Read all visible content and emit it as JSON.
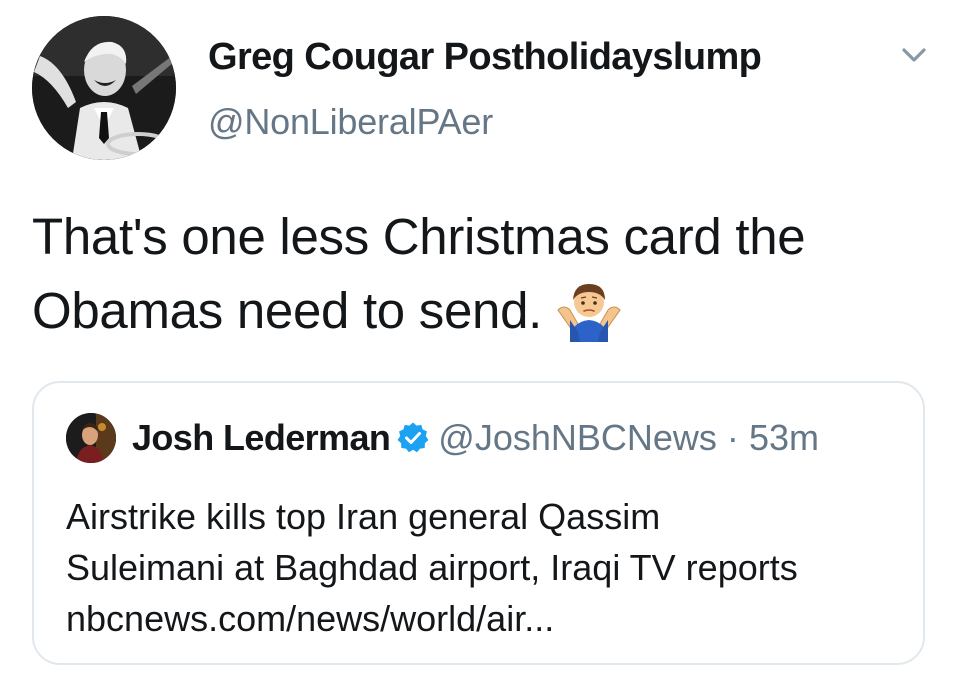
{
  "tweet": {
    "display_name": "Greg Cougar Postholidayslump",
    "handle": "@NonLiberalPAer",
    "text_line1": "That's one less Christmas card the",
    "text_line2": "Obamas need to send.",
    "emoji_icon": "person-shrugging-icon",
    "caret_icon": "chevron-down-icon"
  },
  "quoted_tweet": {
    "display_name": "Josh Lederman",
    "verified_icon": "verified-badge-icon",
    "handle": "@JoshNBCNews",
    "separator": "·",
    "time": "53m",
    "text_line1": "Airstrike kills top Iran general Qassim",
    "text_line2": "Suleimani at Baghdad airport, Iraqi TV reports",
    "link": "nbcnews.com/news/world/air..."
  },
  "colors": {
    "text_primary": "#14171a",
    "text_secondary": "#657786",
    "border": "#e1e8ed",
    "verified_blue": "#1da1f2"
  }
}
